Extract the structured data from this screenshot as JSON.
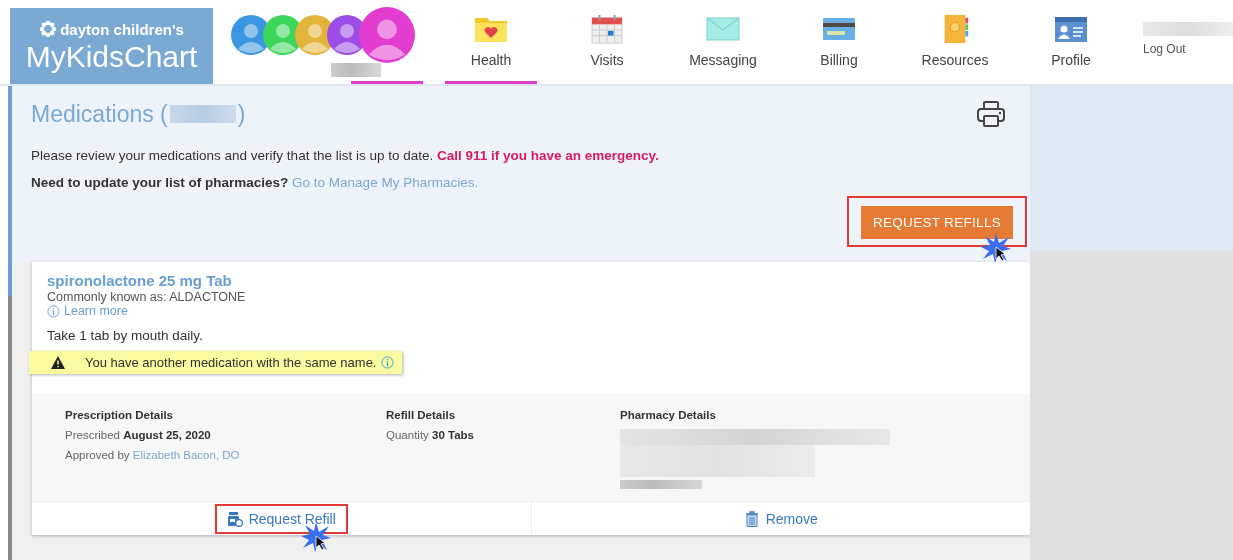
{
  "header": {
    "logo": {
      "org": "dayton children's",
      "product": "MyKidsChart"
    },
    "avatars": [
      {
        "color": "#3a96e0",
        "selected": false
      },
      {
        "color": "#3cd65a",
        "selected": false
      },
      {
        "color": "#e2b43a",
        "selected": false
      },
      {
        "color": "#9b4de6",
        "selected": false
      },
      {
        "color": "#e23cd0",
        "selected": true
      }
    ],
    "nav": [
      {
        "kind": "health",
        "label": "Health",
        "selected": true
      },
      {
        "kind": "visits",
        "label": "Visits",
        "selected": false
      },
      {
        "kind": "messaging",
        "label": "Messaging",
        "selected": false
      },
      {
        "kind": "billing",
        "label": "Billing",
        "selected": false
      },
      {
        "kind": "resources",
        "label": "Resources",
        "selected": false
      },
      {
        "kind": "profile",
        "label": "Profile",
        "selected": false
      }
    ],
    "logout": "Log Out"
  },
  "page": {
    "title_prefix": "Medications (",
    "title_suffix": ")",
    "intro": "Please review your medications and verify that the list is up to date.",
    "emergency": "Call 911 if you have an emergency.",
    "pharmacy_question": "Need to update your list of pharmacies?",
    "pharmacy_link": "Go to Manage My Pharmacies.",
    "request_refills": {
      "label": "REQUEST REFILLS",
      "highlighted": true
    }
  },
  "medications": [
    {
      "name": "spironolactone 25 mg Tab",
      "common": "Commonly known as: ALDACTONE",
      "learn_more": "Learn more",
      "instructions": "Take 1 tab by mouth daily.",
      "warning": "You have another medication with the same name.",
      "prescription": {
        "heading": "Prescription Details",
        "prescribed_label": "Prescribed",
        "prescribed_date": "August 25, 2020",
        "approved_label": "Approved by",
        "approver": "Elizabeth Bacon, DO"
      },
      "refill": {
        "heading": "Refill Details",
        "quantity_label": "Quantity",
        "quantity": "30 Tabs"
      },
      "pharmacy": {
        "heading": "Pharmacy Details"
      },
      "actions": [
        {
          "kind": "refill",
          "label": "Request Refill",
          "highlighted": true
        },
        {
          "kind": "remove",
          "label": "Remove",
          "highlighted": false
        }
      ]
    }
  ]
}
